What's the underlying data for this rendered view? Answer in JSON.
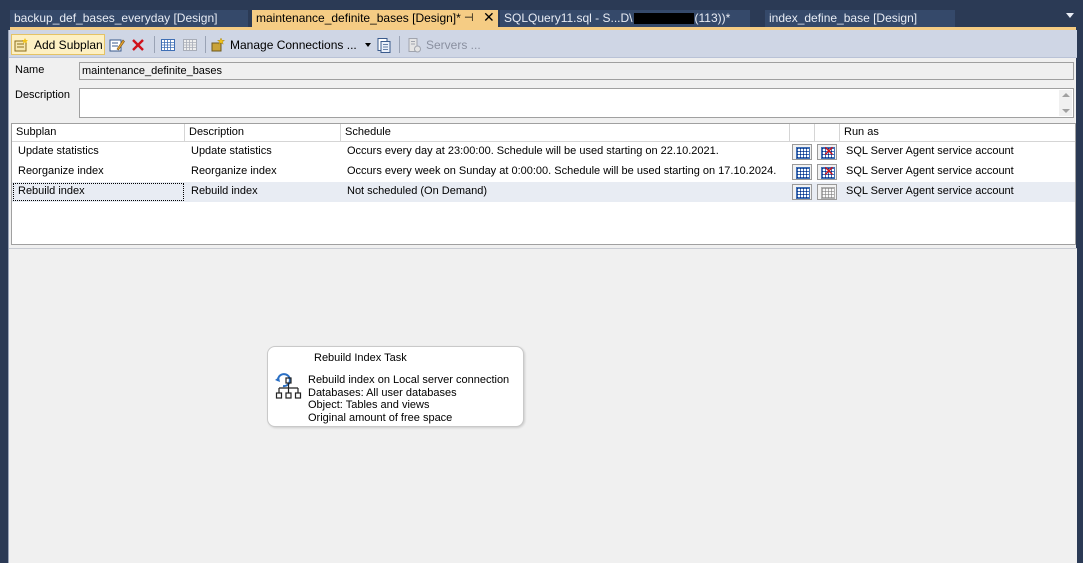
{
  "tabs": [
    {
      "label": "backup_def_bases_everyday [Design]"
    },
    {
      "label": "maintenance_definite_bases [Design]*"
    },
    {
      "label_prefix": "SQLQuery11.sql - S...D\\",
      "label_suffix": "(113))*"
    },
    {
      "label": "index_define_base [Design]"
    }
  ],
  "toolbar": {
    "add_subplan": "Add Subplan",
    "manage_connections": "Manage Connections ...",
    "servers": "Servers ..."
  },
  "form": {
    "name_label": "Name",
    "name_value": "maintenance_definite_bases",
    "description_label": "Description",
    "description_value": ""
  },
  "grid": {
    "headers": {
      "subplan": "Subplan",
      "description": "Description",
      "schedule": "Schedule",
      "run_as": "Run as"
    },
    "rows": [
      {
        "subplan": "Update statistics",
        "description": "Update statistics",
        "schedule": "Occurs every day at 23:00:00. Schedule will be used starting on 22.10.2021.",
        "run_as": "SQL Server Agent service account"
      },
      {
        "subplan": "Reorganize index",
        "description": "Reorganize index",
        "schedule": "Occurs every week on Sunday at 0:00:00. Schedule will be used starting on 17.10.2024.",
        "run_as": "SQL Server Agent service account"
      },
      {
        "subplan": "Rebuild index",
        "description": "Rebuild index",
        "schedule": "Not scheduled (On Demand)",
        "run_as": "SQL Server Agent service account"
      }
    ]
  },
  "task": {
    "title": "Rebuild Index Task",
    "lines": [
      "Rebuild index on Local server connection",
      "Databases: All user databases",
      "Object: Tables and views",
      "Original amount of free space"
    ]
  },
  "colors": {
    "active_tab": "#f5cc84",
    "frame": "#2b3a55",
    "toolbar": "#cfd6e5"
  }
}
